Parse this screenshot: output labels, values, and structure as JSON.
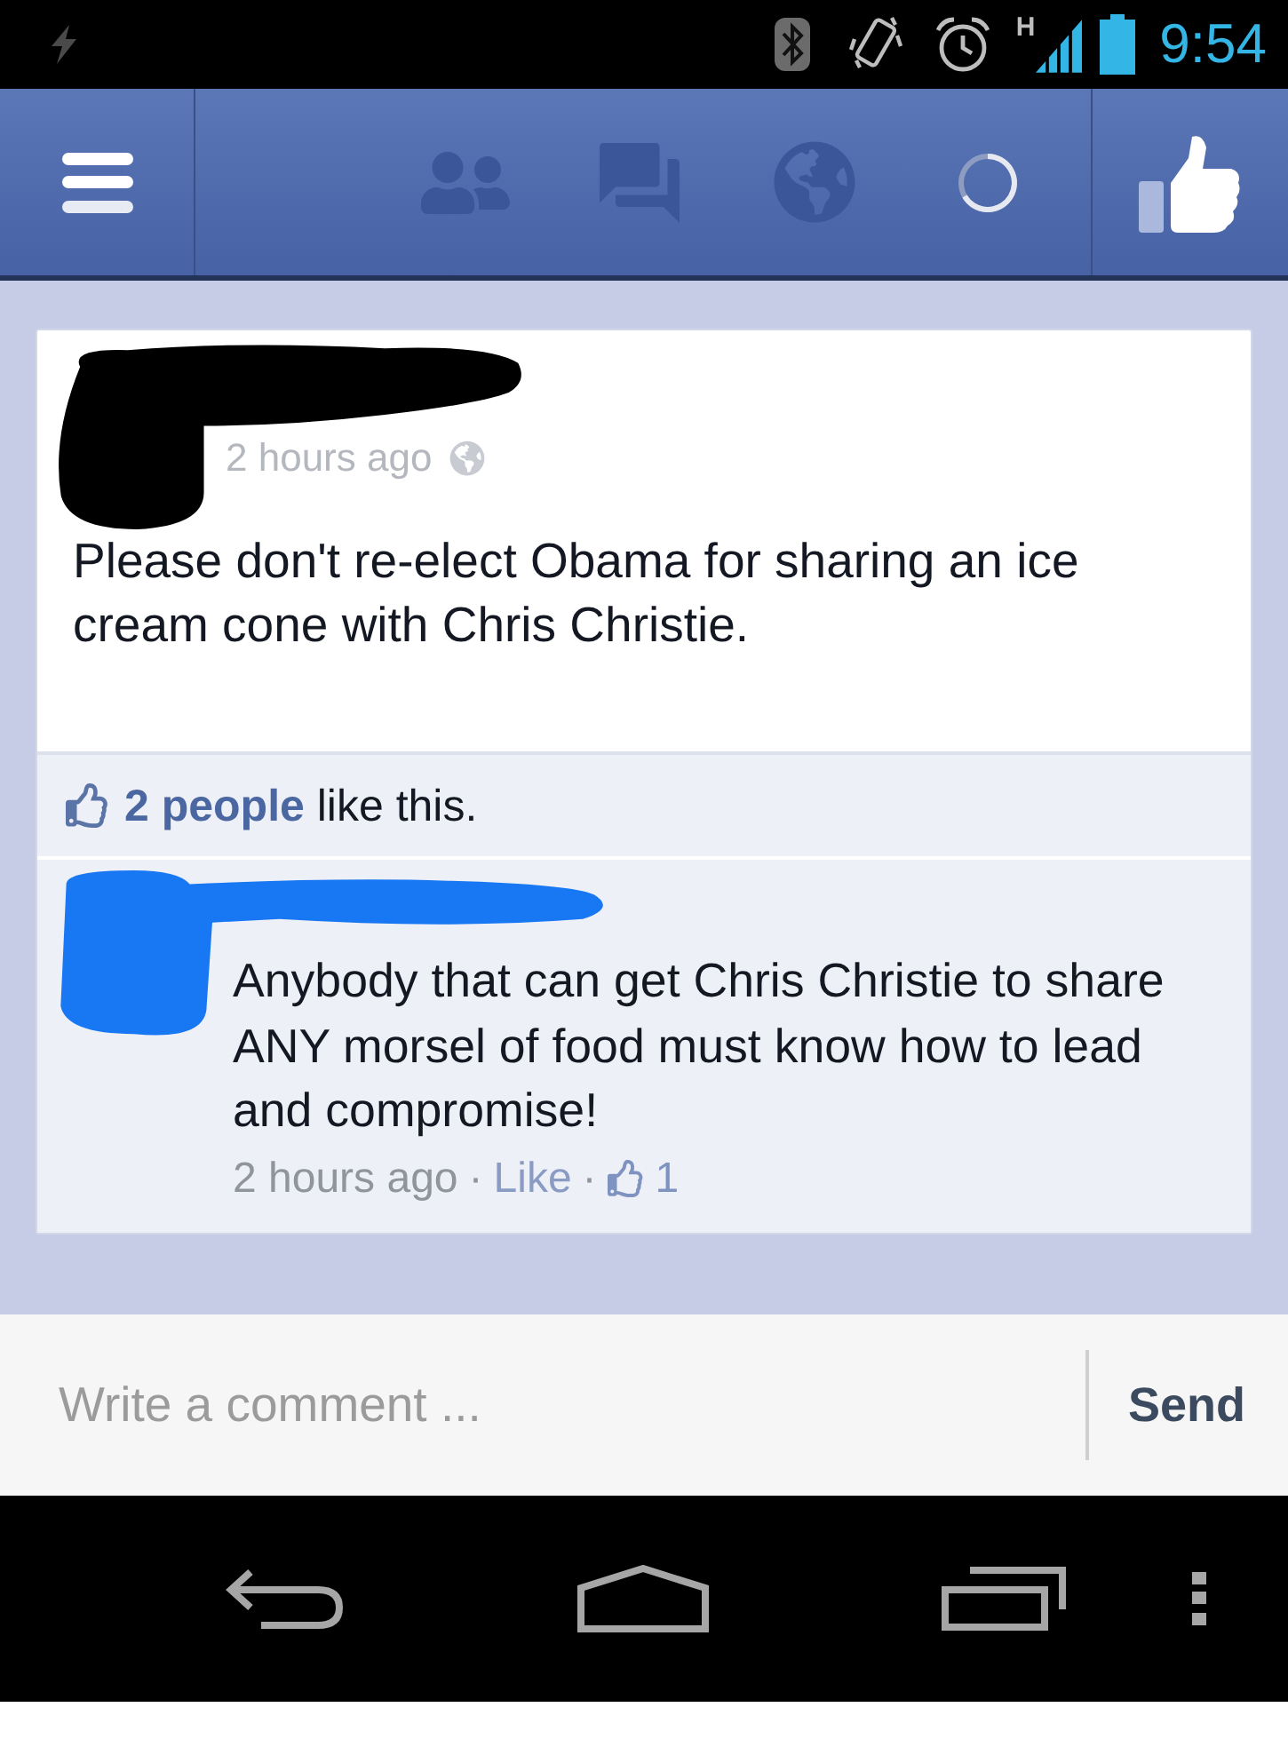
{
  "status_bar": {
    "network_type": "H",
    "time": "9:54"
  },
  "post": {
    "timestamp": "2 hours ago",
    "text": "Please don't re-elect Obama for sharing an ice cream cone with Chris Christie."
  },
  "likes": {
    "text": "**2 people** like this."
  },
  "comments": [
    {
      "text": "Anybody that can get Chris Christie to share ANY morsel of food must know how to lead and compromise!",
      "time": "2 hours ago",
      "separator": "·",
      "like_label": "Like",
      "like_count": "1"
    }
  ],
  "composer": {
    "placeholder": "Write a comment ...",
    "send_label": "Send"
  }
}
